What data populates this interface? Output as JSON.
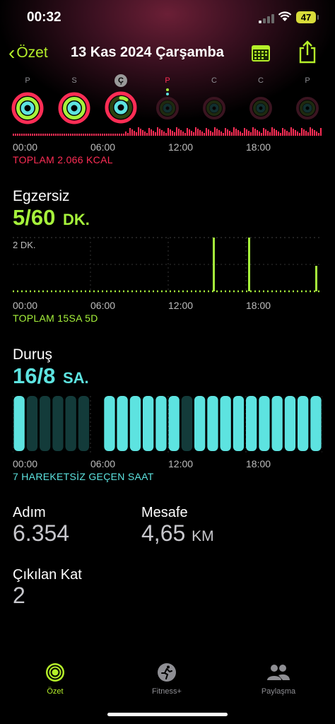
{
  "status_bar": {
    "time": "00:32",
    "battery": "47"
  },
  "nav": {
    "back_label": "Özet",
    "title": "13 Kas 2024 Çarşamba"
  },
  "week": [
    {
      "label": "P",
      "state": "full"
    },
    {
      "label": "S",
      "state": "full"
    },
    {
      "label": "Ç",
      "state": "today"
    },
    {
      "label": "P",
      "state": "future-red"
    },
    {
      "label": "C",
      "state": "future"
    },
    {
      "label": "C",
      "state": "future"
    },
    {
      "label": "P",
      "state": "future"
    }
  ],
  "move": {
    "axis": [
      "00:00",
      "06:00",
      "12:00",
      "18:00"
    ],
    "total": "TOPLAM 2.066 KCAL",
    "color": "#ff2d55"
  },
  "exercise": {
    "title": "Egzersiz",
    "value": "5/60",
    "unit": "DK.",
    "chart_label": "2 DK.",
    "axis": [
      "00:00",
      "06:00",
      "12:00",
      "18:00"
    ],
    "total": "TOPLAM 15SA 5D",
    "color": "#a6f23b"
  },
  "stand": {
    "title": "Duruş",
    "value": "16/8",
    "unit": "SA.",
    "axis": [
      "00:00",
      "06:00",
      "12:00",
      "18:00"
    ],
    "total": "7 HAREKETSİZ GEÇEN SAAT",
    "color": "#5de3e0"
  },
  "metrics": {
    "steps_label": "Adım",
    "steps_value": "6.354",
    "distance_label": "Mesafe",
    "distance_value": "4,65",
    "distance_unit": "KM",
    "floors_label": "Çıkılan Kat",
    "floors_value": "2"
  },
  "tabs": [
    {
      "label": "Özet",
      "icon": "rings-icon",
      "active": true
    },
    {
      "label": "Fitness+",
      "icon": "runner-icon",
      "active": false
    },
    {
      "label": "Paylaşma",
      "icon": "people-icon",
      "active": false
    }
  ]
}
